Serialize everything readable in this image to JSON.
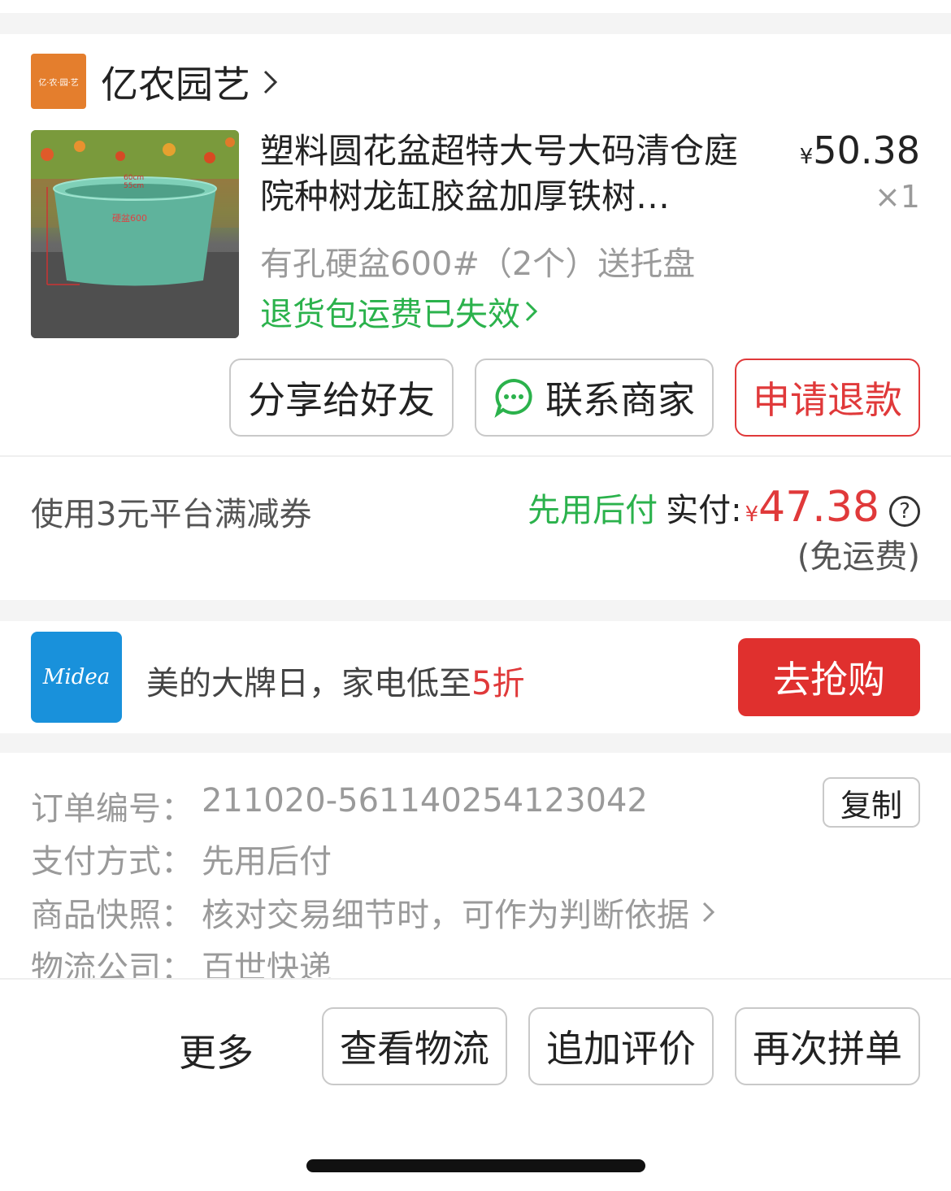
{
  "shop": {
    "logo_text": "亿·农·园·艺",
    "name": "亿农园艺"
  },
  "product": {
    "title": "塑料圆花盆超特大号大码清仓庭院种树龙缸胶盆加厚铁树…",
    "price_symbol": "¥",
    "price": "50.38",
    "quantity": "×1",
    "spec": "有孔硬盆600#（2个）送托盘",
    "return_status": "退货包运费已失效",
    "image_labels": {
      "top": "60cm",
      "bottom": "55cm",
      "middle": "硬盆600"
    }
  },
  "actions": {
    "share": "分享给好友",
    "contact": "联系商家",
    "refund": "申请退款"
  },
  "payment": {
    "coupon": "使用3元平台满减券",
    "method_tag": "先用后付",
    "paid_label": "实付:",
    "currency": "¥",
    "amount": "47.38",
    "shipping": "(免运费)"
  },
  "promo": {
    "logo_text": "Midea",
    "text_prefix": "美的大牌日，家电低至",
    "text_highlight": "5折",
    "button": "去抢购"
  },
  "order": {
    "copy_button": "复制",
    "rows": [
      {
        "label": "订单编号：",
        "value": "211020-561140254123042"
      },
      {
        "label": "支付方式：",
        "value": "先用后付"
      },
      {
        "label": "商品快照：",
        "value": "核对交易细节时，可作为判断依据"
      },
      {
        "label": "物流公司：",
        "value": "百世快递"
      }
    ]
  },
  "bottom_bar": {
    "more": "更多",
    "logistics": "查看物流",
    "review": "追加评价",
    "reorder": "再次拼单"
  },
  "colors": {
    "green": "#2bb24c",
    "red": "#e0393a",
    "shop_logo_bg": "#e47e2d",
    "midea_blue": "#1991db"
  }
}
